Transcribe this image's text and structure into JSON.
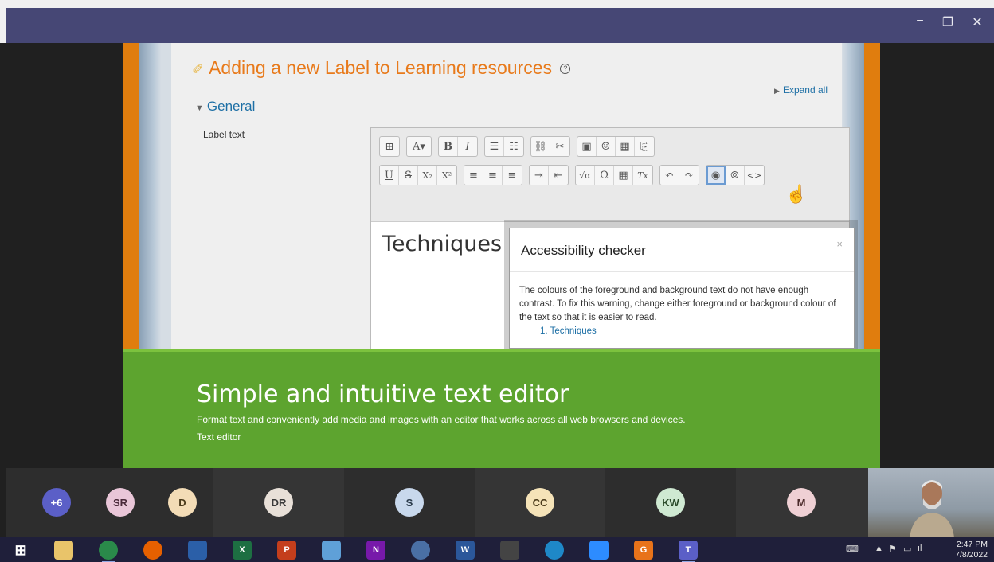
{
  "window": {
    "minimize": "−",
    "maximize": "❐",
    "close": "✕"
  },
  "moodle": {
    "page_title": "Adding a new Label to Learning resources",
    "expand_all": "Expand all",
    "section_general": "General",
    "label_text": "Label text",
    "editor_content": "Techniques"
  },
  "toolbar": {
    "row1": [
      [
        "⊞"
      ],
      [
        "A▾"
      ],
      [
        "B",
        "I"
      ],
      [
        "☰",
        "☷"
      ],
      [
        "⛓",
        "✂"
      ],
      [
        "▣",
        "☺",
        "▦",
        "⎘"
      ]
    ],
    "row2": [
      [
        "U",
        "S",
        "X₂",
        "X²"
      ],
      [
        "≡",
        "≡",
        "≡"
      ],
      [
        "⇥",
        "⇤"
      ],
      [
        "√α",
        "Ω",
        "▦",
        "Tx"
      ],
      [
        "↶",
        "↷"
      ],
      [
        "◉",
        "⦾",
        "<>"
      ]
    ]
  },
  "dialog": {
    "title": "Accessibility checker",
    "close": "×",
    "message": "The colours of the foreground and background text do not have enough contrast. To fix this warning, change either foreground or background colour of the text so that it is easier to read.",
    "list_item": "1. Techniques"
  },
  "banner": {
    "title": "Simple and intuitive text editor",
    "description": "Format text and conveniently add media and images with an editor that works across all web browsers and devices.",
    "link": "Text editor"
  },
  "participants": [
    {
      "initials": "+6",
      "bg": "#5b5fc7",
      "fg": "#ffffff"
    },
    {
      "initials": "SR",
      "bg": "#e9c6d8",
      "fg": "#4a2a3a"
    },
    {
      "initials": "D",
      "bg": "#f3dcb6",
      "fg": "#4a3a1a"
    },
    {
      "initials": "DR",
      "bg": "#e8e0d8",
      "fg": "#3a3a3a"
    },
    {
      "initials": "S",
      "bg": "#c8d8ec",
      "fg": "#2a3a4a"
    },
    {
      "initials": "CC",
      "bg": "#f5e3b8",
      "fg": "#4a3a1a"
    },
    {
      "initials": "KW",
      "bg": "#cfe9d2",
      "fg": "#2a4a2a"
    },
    {
      "initials": "M",
      "bg": "#efd0d4",
      "fg": "#4a2a2a"
    }
  ],
  "taskbar": {
    "apps": [
      "start",
      "file-explorer",
      "chrome",
      "firefox",
      "media-player",
      "excel",
      "powerpoint",
      "notes",
      "onenote",
      "vpn",
      "word",
      "inkscape",
      "edge",
      "zoom",
      "pdf",
      "teams"
    ],
    "time": "2:47 PM",
    "date": "7/8/2022"
  }
}
